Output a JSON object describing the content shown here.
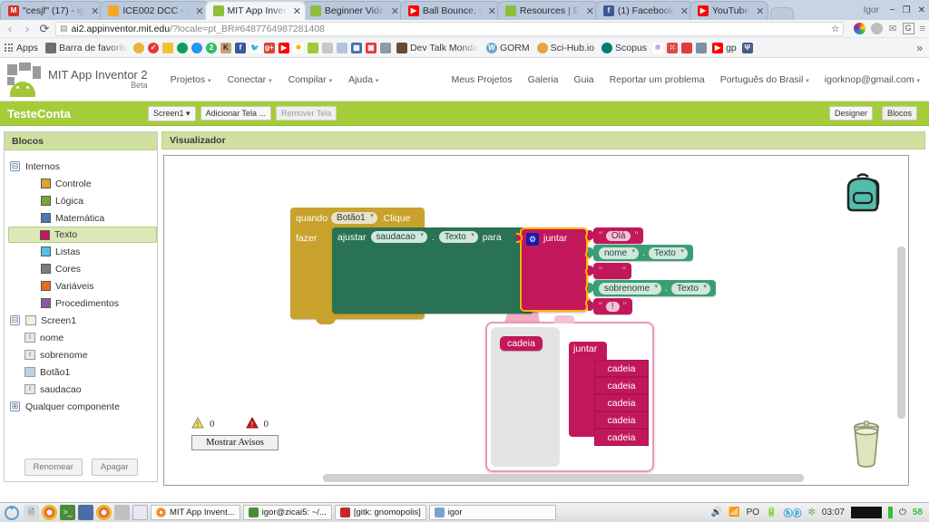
{
  "browser": {
    "tabs": [
      {
        "label": "\"cesjf\" (17) - ig",
        "favicon": "gmail-icon",
        "color": "#d93025",
        "glyph": "M",
        "active": false
      },
      {
        "label": "ICE002 DCC - /",
        "favicon": "moodle-icon",
        "color": "#f5a623",
        "glyph": "",
        "active": false
      },
      {
        "label": "MIT App Inver",
        "favicon": "appinventor-icon",
        "color": "#8bbf3c",
        "glyph": "",
        "active": true
      },
      {
        "label": "Beginner Vide",
        "favicon": "appinventor-icon",
        "color": "#8bbf3c",
        "glyph": "",
        "active": false
      },
      {
        "label": "Ball Bounce, I",
        "favicon": "youtube-icon",
        "color": "#ff0000",
        "glyph": "▶",
        "active": false
      },
      {
        "label": "Resources | E",
        "favicon": "appinventor-icon",
        "color": "#8bbf3c",
        "glyph": "",
        "active": false
      },
      {
        "label": "(1) Facebook",
        "favicon": "facebook-icon",
        "color": "#3b5998",
        "glyph": "f",
        "active": false
      },
      {
        "label": "YouTube",
        "favicon": "youtube-icon",
        "color": "#ff0000",
        "glyph": "▶",
        "active": false
      }
    ],
    "tab_close_glyph": "✕",
    "window_user": "Igor",
    "window_buttons": {
      "minimize": "−",
      "maximize": "❐",
      "close": "✕"
    },
    "nav": {
      "back": "‹",
      "forward": "›",
      "reload": "⟳"
    },
    "url_host": "ai2.appinventor.mit.edu",
    "url_path": "/?locale=pt_BR#6487764987281408",
    "page_icon": "document-icon",
    "star_icon": "☆",
    "menu_icon": "≡",
    "omni_extensions": [
      "color-wheel-icon",
      "extension-icon",
      "envelope-icon",
      "grammarly-icon"
    ],
    "bookmarks": {
      "apps_label": "Apps",
      "folder_label": "Barra de favorito",
      "items": [
        {
          "label": "Dev Talk Monday",
          "color": "#6b4a2f",
          "glyph": ""
        },
        {
          "label": "GORM",
          "color": "#21759b",
          "glyph": "W"
        },
        {
          "label": "Sci-Hub.io",
          "color": "#e8a33d",
          "glyph": ""
        },
        {
          "label": "Scopus",
          "color": "#0b7a6e",
          "glyph": ""
        },
        {
          "label": "gp",
          "color": "#ff0000",
          "glyph": "▶"
        }
      ],
      "overflow_glyph": "»"
    }
  },
  "appinventor": {
    "brand_title": "MIT App Inventor 2",
    "brand_beta": "Beta",
    "menu_left": [
      {
        "label": "Projetos",
        "caret": "▾"
      },
      {
        "label": "Conectar",
        "caret": "▾"
      },
      {
        "label": "Compilar",
        "caret": "▾"
      },
      {
        "label": "Ajuda",
        "caret": "▾"
      }
    ],
    "menu_right": [
      {
        "label": "Meus Projetos",
        "caret": ""
      },
      {
        "label": "Galeria",
        "caret": ""
      },
      {
        "label": "Guia",
        "caret": ""
      },
      {
        "label": "Reportar um problema",
        "caret": ""
      },
      {
        "label": "Português do Brasil",
        "caret": "▾"
      },
      {
        "label": "igorknop@gmail.com",
        "caret": "▾"
      }
    ],
    "project": {
      "name": "TesteConta",
      "screen_select": "Screen1",
      "screen_caret": "▾",
      "add_screen": "Adicionar Tela ...",
      "remove_screen": "Remover Tela",
      "designer_btn": "Designer",
      "blocks_btn": "Blocos"
    }
  },
  "palette": {
    "header": "Blocos",
    "builtin": {
      "label": "Internos",
      "toggle": "⊟",
      "items": [
        {
          "label": "Controle",
          "color": "#d9a62e",
          "selected": false
        },
        {
          "label": "Lógica",
          "color": "#76a82e",
          "selected": false
        },
        {
          "label": "Matemática",
          "color": "#4a77bb",
          "selected": false
        },
        {
          "label": "Texto",
          "color": "#c2185b",
          "selected": true
        },
        {
          "label": "Listas",
          "color": "#4fc3e8",
          "selected": false
        },
        {
          "label": "Cores",
          "color": "#7d7d7d",
          "selected": false
        },
        {
          "label": "Variáveis",
          "color": "#ea6a1e",
          "selected": false
        },
        {
          "label": "Procedimentos",
          "color": "#8659a5",
          "selected": false
        }
      ]
    },
    "screen": {
      "label": "Screen1",
      "toggle": "⊟",
      "icon": "screen-icon",
      "components": [
        {
          "label": "nome",
          "icon": "textbox-icon"
        },
        {
          "label": "sobrenome",
          "icon": "textbox-icon"
        },
        {
          "label": "Botão1",
          "icon": "button-icon"
        },
        {
          "label": "saudacao",
          "icon": "label-icon"
        }
      ]
    },
    "any_component": {
      "label": "Qualquer componente",
      "toggle": "⊞"
    },
    "rename_btn": "Renomear",
    "delete_btn": "Apagar"
  },
  "workspace": {
    "header": "Visualizador",
    "blocks": {
      "when": {
        "keyword": "quando",
        "component": "Botão1",
        "event": ".Clique",
        "do_label": "fazer"
      },
      "set": {
        "keyword": "ajustar",
        "component": "saudacao",
        "dot": ".",
        "property": "Texto",
        "to": "para"
      },
      "join": {
        "label": "juntar",
        "mutator_icon": "gear-icon"
      },
      "args": [
        {
          "type": "text",
          "value": "Olá",
          "quote": "\""
        },
        {
          "type": "getter",
          "component": "nome",
          "dot": ".",
          "property": "Texto"
        },
        {
          "type": "text",
          "value": " ",
          "quote": "\""
        },
        {
          "type": "getter",
          "component": "sobrenome",
          "dot": ".",
          "property": "Texto"
        },
        {
          "type": "text",
          "value": "!",
          "quote": "\""
        }
      ]
    },
    "mutator": {
      "palette_item": "cadeia",
      "join_label": "juntar",
      "rows": [
        "cadeia",
        "cadeia",
        "cadeia",
        "cadeia",
        "cadeia"
      ]
    },
    "backpack_icon": "backpack-icon",
    "trash_icon": "trashcan-icon",
    "warnings": {
      "warn_count": "0",
      "error_count": "0",
      "warn_icon": "warning-triangle-icon",
      "error_icon": "error-triangle-icon",
      "show_warnings_btn": "Mostrar Avisos"
    }
  },
  "taskbar": {
    "launcher_icon": "ubuntu-icon",
    "quick_icons": [
      "files-icon",
      "chrome-icon",
      "terminal-icon",
      "monitor-icon",
      "chrome2-icon",
      "blank-icon",
      "window-icon"
    ],
    "windows": [
      {
        "label": "MIT App Invent...",
        "icon": "chrome-icon",
        "color": "#4caf50"
      },
      {
        "label": "igor@zicai5: ~/...",
        "icon": "terminal-icon",
        "color": "#4b8b3b"
      },
      {
        "label": "[gitk: gnomopolis]",
        "icon": "gitk-icon",
        "color": "#c62828"
      },
      {
        "label": "igor",
        "icon": "window-icon",
        "color": "#7aa2d0"
      }
    ],
    "tray": {
      "volume_icon": "volume-icon",
      "signal_icon": "signal-icon",
      "keyboard_layout": "PO",
      "battery_icon": "battery-icon",
      "hp_icon": "hp-icon",
      "sync_icon": "sync-icon",
      "clock": "03:07",
      "battery_percent": "58",
      "power_icon": "power-icon"
    }
  }
}
